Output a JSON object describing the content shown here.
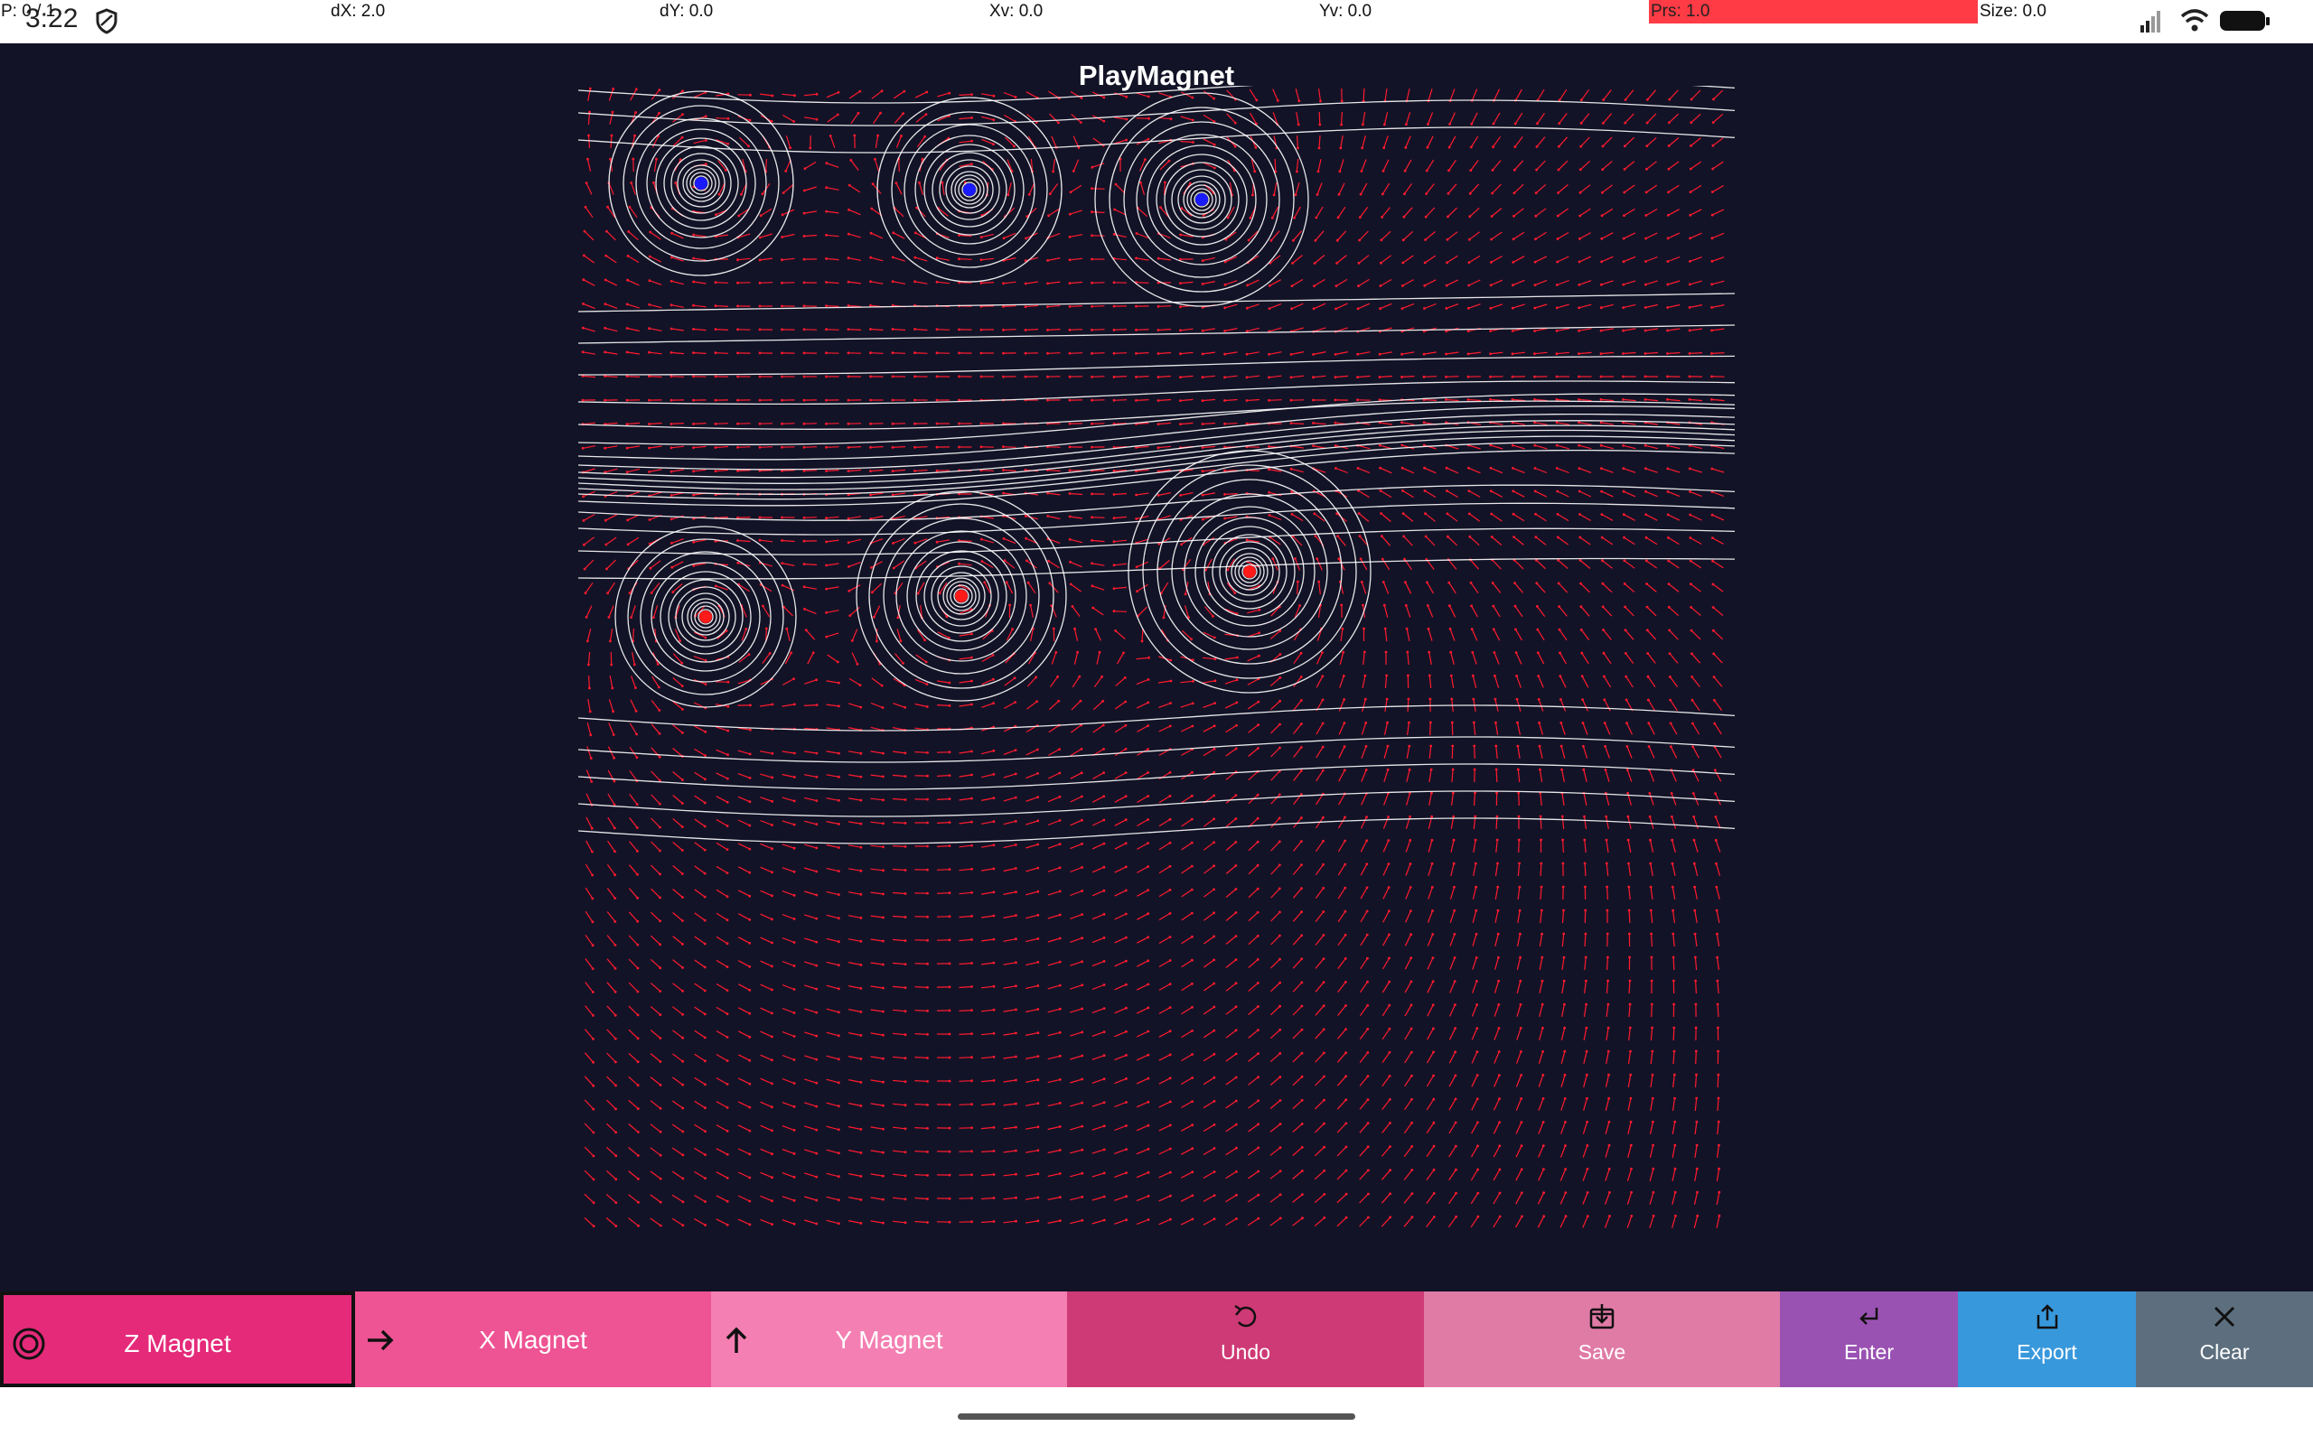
{
  "status": {
    "time": "3:22",
    "pointer": "P: 0 / 1",
    "dx": "dX: 2.0",
    "dy": "dY: 0.0",
    "xv": "Xv: 0.0",
    "yv": "Yv: 0.0",
    "prs": "Prs: 1.0",
    "size": "Size: 0.0",
    "icons": [
      "shield-icon",
      "signal-icon",
      "wifi-icon",
      "battery-icon"
    ]
  },
  "app": {
    "title": "PlayMagnet"
  },
  "field": {
    "background": "#131327",
    "line_color": "#ffffff",
    "arrow_color": "#ff1a2e",
    "magnets": [
      {
        "pole": "blue",
        "color": "#1a1aff"
      },
      {
        "pole": "blue",
        "color": "#1a1aff"
      },
      {
        "pole": "blue",
        "color": "#1a1aff"
      },
      {
        "pole": "red",
        "color": "#ff1a1a"
      },
      {
        "pole": "red",
        "color": "#ff1a1a"
      },
      {
        "pole": "red",
        "color": "#ff1a1a"
      }
    ]
  },
  "toolbar": {
    "z_magnet": {
      "label": "Z Magnet",
      "icon": "target-icon",
      "color": "#e52a7a",
      "selected": true
    },
    "x_magnet": {
      "label": "X Magnet",
      "icon": "arrow-right-icon",
      "color": "#ee5393"
    },
    "y_magnet": {
      "label": "Y Magnet",
      "icon": "arrow-up-icon",
      "color": "#f47fb2"
    },
    "undo": {
      "label": "Undo",
      "icon": "undo-icon",
      "color": "#ce3a75"
    },
    "save": {
      "label": "Save",
      "icon": "save-icon",
      "color": "#e07ba6"
    },
    "enter": {
      "label": "Enter",
      "icon": "enter-icon",
      "color": "#9a52b2"
    },
    "export": {
      "label": "Export",
      "icon": "export-icon",
      "color": "#3898dc"
    },
    "clear": {
      "label": "Clear",
      "icon": "close-icon",
      "color": "#5d6f7e"
    }
  }
}
